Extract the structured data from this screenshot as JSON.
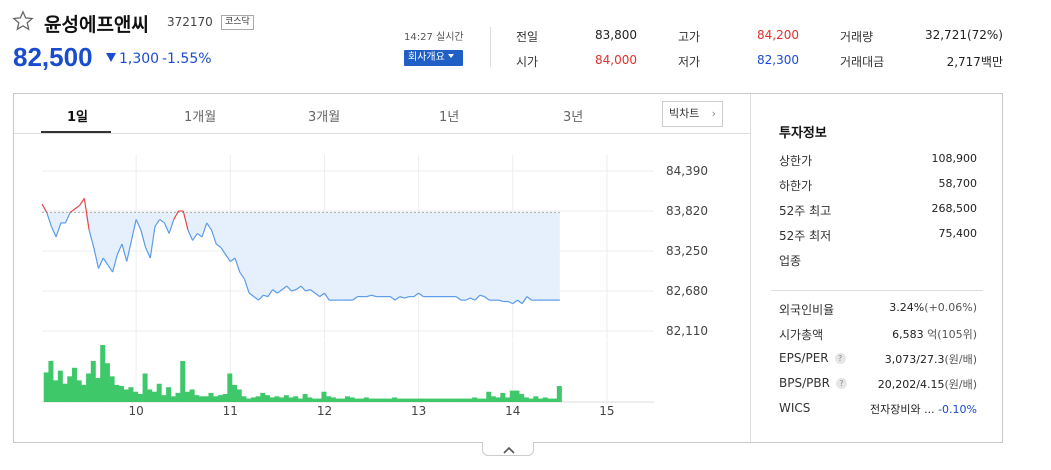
{
  "stock": {
    "name": "윤성에프앤씨",
    "code": "372170",
    "market_badge": "코스닥",
    "price": "82,500",
    "change": "1,300",
    "change_pct": "-1.55%",
    "realtime_label": "14:27 실시간",
    "company_button": "회사개요"
  },
  "quote": {
    "prev_close_label": "전일",
    "prev_close": "83,800",
    "high_label": "고가",
    "high": "84,200",
    "volume_label": "거래량",
    "volume": "32,721(72%)",
    "open_label": "시가",
    "open": "84,000",
    "low_label": "저가",
    "low": "82,300",
    "amount_label": "거래대금",
    "amount": "2,717백만"
  },
  "tabs": [
    "1일",
    "1개월",
    "3개월",
    "1년",
    "3년"
  ],
  "big_chart_button": "빅차트",
  "invest": {
    "title": "투자정보",
    "upper_limit_label": "상한가",
    "upper_limit": "108,900",
    "lower_limit_label": "하한가",
    "lower_limit": "58,700",
    "high52_label": "52주 최고",
    "high52": "268,500",
    "low52_label": "52주 최저",
    "low52": "75,400",
    "industry_label": "업종",
    "foreign_label": "외국인비율",
    "foreign_val": "3.24%",
    "foreign_chg": "(+0.06%)",
    "mcap_label": "시가총액",
    "mcap_val": "6,583",
    "mcap_unit": "억(105위)",
    "eps_label": "EPS/PER",
    "eps_val": "3,073/27.3",
    "eps_unit": "(원/배)",
    "bps_label": "BPS/PBR",
    "bps_val": "20,202/4.15",
    "bps_unit": "(원/배)",
    "wics_label": "WICS",
    "wics_val": "전자장비와 ...",
    "wics_chg": "-0.10%"
  },
  "chart_data": {
    "type": "line",
    "x_ticks": [
      "10",
      "11",
      "12",
      "13",
      "14",
      "15"
    ],
    "y_ticks": [
      "84,390",
      "83,820",
      "83,250",
      "82,680",
      "82,110"
    ],
    "ylim": [
      82110,
      84390
    ],
    "x_range": [
      9.0,
      15.5
    ],
    "prev_close": 83800,
    "price": [
      [
        9.0,
        83920
      ],
      [
        9.05,
        83800
      ],
      [
        9.1,
        83600
      ],
      [
        9.15,
        83450
      ],
      [
        9.2,
        83650
      ],
      [
        9.25,
        83650
      ],
      [
        9.3,
        83800
      ],
      [
        9.35,
        83850
      ],
      [
        9.4,
        83900
      ],
      [
        9.45,
        84000
      ],
      [
        9.5,
        83550
      ],
      [
        9.55,
        83300
      ],
      [
        9.6,
        83000
      ],
      [
        9.65,
        83150
      ],
      [
        9.7,
        83050
      ],
      [
        9.75,
        82950
      ],
      [
        9.8,
        83200
      ],
      [
        9.85,
        83350
      ],
      [
        9.9,
        83100
      ],
      [
        9.95,
        83400
      ],
      [
        10.0,
        83700
      ],
      [
        10.05,
        83550
      ],
      [
        10.1,
        83300
      ],
      [
        10.15,
        83150
      ],
      [
        10.2,
        83600
      ],
      [
        10.25,
        83700
      ],
      [
        10.3,
        83650
      ],
      [
        10.35,
        83500
      ],
      [
        10.4,
        83700
      ],
      [
        10.45,
        83820
      ],
      [
        10.5,
        83820
      ],
      [
        10.55,
        83550
      ],
      [
        10.6,
        83400
      ],
      [
        10.65,
        83500
      ],
      [
        10.7,
        83450
      ],
      [
        10.75,
        83650
      ],
      [
        10.8,
        83550
      ],
      [
        10.85,
        83350
      ],
      [
        10.9,
        83300
      ],
      [
        10.95,
        83200
      ],
      [
        11.0,
        83100
      ],
      [
        11.05,
        83150
      ],
      [
        11.1,
        82950
      ],
      [
        11.15,
        82850
      ],
      [
        11.2,
        82650
      ],
      [
        11.25,
        82600
      ],
      [
        11.3,
        82550
      ],
      [
        11.35,
        82620
      ],
      [
        11.4,
        82600
      ],
      [
        11.45,
        82700
      ],
      [
        11.5,
        82650
      ],
      [
        11.55,
        82700
      ],
      [
        11.6,
        82750
      ],
      [
        11.65,
        82680
      ],
      [
        11.7,
        82700
      ],
      [
        11.75,
        82750
      ],
      [
        11.8,
        82680
      ],
      [
        11.85,
        82700
      ],
      [
        11.9,
        82650
      ],
      [
        11.95,
        82600
      ],
      [
        12.0,
        82650
      ],
      [
        12.05,
        82550
      ],
      [
        12.1,
        82550
      ],
      [
        12.15,
        82550
      ],
      [
        12.2,
        82550
      ],
      [
        12.3,
        82550
      ],
      [
        12.35,
        82600
      ],
      [
        12.4,
        82600
      ],
      [
        12.45,
        82600
      ],
      [
        12.5,
        82620
      ],
      [
        12.55,
        82600
      ],
      [
        12.6,
        82600
      ],
      [
        12.7,
        82600
      ],
      [
        12.75,
        82550
      ],
      [
        12.8,
        82600
      ],
      [
        12.85,
        82580
      ],
      [
        12.9,
        82600
      ],
      [
        12.95,
        82600
      ],
      [
        13.0,
        82650
      ],
      [
        13.05,
        82600
      ],
      [
        13.1,
        82600
      ],
      [
        13.2,
        82600
      ],
      [
        13.3,
        82600
      ],
      [
        13.35,
        82600
      ],
      [
        13.4,
        82600
      ],
      [
        13.45,
        82550
      ],
      [
        13.5,
        82550
      ],
      [
        13.55,
        82580
      ],
      [
        13.6,
        82550
      ],
      [
        13.65,
        82620
      ],
      [
        13.7,
        82600
      ],
      [
        13.75,
        82550
      ],
      [
        13.8,
        82550
      ],
      [
        13.85,
        82550
      ],
      [
        13.9,
        82530
      ],
      [
        13.95,
        82530
      ],
      [
        14.0,
        82500
      ],
      [
        14.05,
        82550
      ],
      [
        14.1,
        82500
      ],
      [
        14.15,
        82600
      ],
      [
        14.2,
        82550
      ],
      [
        14.25,
        82550
      ],
      [
        14.3,
        82550
      ],
      [
        14.4,
        82550
      ],
      [
        14.5,
        82550
      ]
    ],
    "volume": [
      [
        9.05,
        0.52
      ],
      [
        9.1,
        0.72
      ],
      [
        9.15,
        0.38
      ],
      [
        9.2,
        0.55
      ],
      [
        9.25,
        0.32
      ],
      [
        9.3,
        0.45
      ],
      [
        9.35,
        0.6
      ],
      [
        9.4,
        0.38
      ],
      [
        9.45,
        0.3
      ],
      [
        9.5,
        0.5
      ],
      [
        9.55,
        0.72
      ],
      [
        9.6,
        0.42
      ],
      [
        9.65,
        1.0
      ],
      [
        9.7,
        0.68
      ],
      [
        9.75,
        0.45
      ],
      [
        9.8,
        0.3
      ],
      [
        9.85,
        0.28
      ],
      [
        9.9,
        0.22
      ],
      [
        9.95,
        0.26
      ],
      [
        10.0,
        0.18
      ],
      [
        10.05,
        0.14
      ],
      [
        10.1,
        0.5
      ],
      [
        10.15,
        0.22
      ],
      [
        10.2,
        0.18
      ],
      [
        10.25,
        0.32
      ],
      [
        10.3,
        0.12
      ],
      [
        10.35,
        0.26
      ],
      [
        10.4,
        0.1
      ],
      [
        10.45,
        0.16
      ],
      [
        10.5,
        0.72
      ],
      [
        10.55,
        0.18
      ],
      [
        10.6,
        0.22
      ],
      [
        10.65,
        0.12
      ],
      [
        10.7,
        0.1
      ],
      [
        10.75,
        0.1
      ],
      [
        10.8,
        0.16
      ],
      [
        10.85,
        0.1
      ],
      [
        10.9,
        0.12
      ],
      [
        10.95,
        0.14
      ],
      [
        11.0,
        0.5
      ],
      [
        11.05,
        0.3
      ],
      [
        11.1,
        0.22
      ],
      [
        11.15,
        0.1
      ],
      [
        11.2,
        0.06
      ],
      [
        11.25,
        0.08
      ],
      [
        11.3,
        0.1
      ],
      [
        11.35,
        0.16
      ],
      [
        11.4,
        0.12
      ],
      [
        11.45,
        0.08
      ],
      [
        11.5,
        0.1
      ],
      [
        11.55,
        0.08
      ],
      [
        11.6,
        0.12
      ],
      [
        11.65,
        0.08
      ],
      [
        11.7,
        0.1
      ],
      [
        11.75,
        0.06
      ],
      [
        11.8,
        0.14
      ],
      [
        11.85,
        0.08
      ],
      [
        11.9,
        0.06
      ],
      [
        11.95,
        0.06
      ],
      [
        12.0,
        0.18
      ],
      [
        12.05,
        0.1
      ],
      [
        12.1,
        0.08
      ],
      [
        12.15,
        0.06
      ],
      [
        12.2,
        0.06
      ],
      [
        12.25,
        0.1
      ],
      [
        12.3,
        0.08
      ],
      [
        12.35,
        0.06
      ],
      [
        12.4,
        0.06
      ],
      [
        12.45,
        0.08
      ],
      [
        12.5,
        0.06
      ],
      [
        12.55,
        0.06
      ],
      [
        12.6,
        0.06
      ],
      [
        12.65,
        0.06
      ],
      [
        12.7,
        0.06
      ],
      [
        12.75,
        0.08
      ],
      [
        12.8,
        0.06
      ],
      [
        12.85,
        0.06
      ],
      [
        12.9,
        0.06
      ],
      [
        12.95,
        0.06
      ],
      [
        13.0,
        0.06
      ],
      [
        13.05,
        0.06
      ],
      [
        13.1,
        0.06
      ],
      [
        13.15,
        0.06
      ],
      [
        13.2,
        0.06
      ],
      [
        13.25,
        0.06
      ],
      [
        13.3,
        0.06
      ],
      [
        13.35,
        0.06
      ],
      [
        13.4,
        0.06
      ],
      [
        13.45,
        0.06
      ],
      [
        13.5,
        0.06
      ],
      [
        13.55,
        0.06
      ],
      [
        13.6,
        0.08
      ],
      [
        13.65,
        0.06
      ],
      [
        13.7,
        0.06
      ],
      [
        13.75,
        0.18
      ],
      [
        13.8,
        0.1
      ],
      [
        13.85,
        0.08
      ],
      [
        13.9,
        0.16
      ],
      [
        13.95,
        0.08
      ],
      [
        14.0,
        0.2
      ],
      [
        14.05,
        0.2
      ],
      [
        14.1,
        0.14
      ],
      [
        14.15,
        0.08
      ],
      [
        14.2,
        0.06
      ],
      [
        14.25,
        0.1
      ],
      [
        14.3,
        0.06
      ],
      [
        14.35,
        0.08
      ],
      [
        14.4,
        0.06
      ],
      [
        14.45,
        0.06
      ],
      [
        14.5,
        0.28
      ]
    ]
  }
}
